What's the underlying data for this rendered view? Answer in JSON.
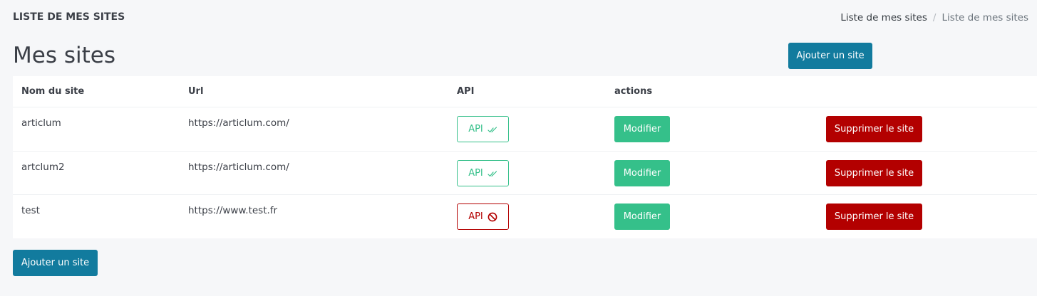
{
  "header": {
    "title": "LISTE DE MES SITES",
    "breadcrumb": [
      "Liste de mes sites",
      "Liste de mes sites"
    ],
    "breadcrumb_separator": "/"
  },
  "main": {
    "heading": "Mes sites",
    "add_button_label": "Ajouter un site"
  },
  "table": {
    "columns": [
      "Nom du site",
      "Url",
      "API",
      "actions"
    ],
    "rows": [
      {
        "name": "articlum",
        "url": "https://articlum.com/",
        "api_label": "API",
        "api_status": "enabled",
        "edit_label": "Modifier",
        "delete_label": "Supprimer le site"
      },
      {
        "name": "artclum2",
        "url": "https://articlum.com/",
        "api_label": "API",
        "api_status": "enabled",
        "edit_label": "Modifier",
        "delete_label": "Supprimer le site"
      },
      {
        "name": "test",
        "url": "https://www.test.fr",
        "api_label": "API",
        "api_status": "disabled",
        "edit_label": "Modifier",
        "delete_label": "Supprimer le site"
      }
    ]
  },
  "footer": {
    "add_button_label": "Ajouter un site"
  },
  "colors": {
    "primary": "#127b9e",
    "success": "#35c08a",
    "danger": "#b30000"
  },
  "icons": {
    "api_enabled": "double-check-icon",
    "api_disabled": "ban-icon"
  }
}
